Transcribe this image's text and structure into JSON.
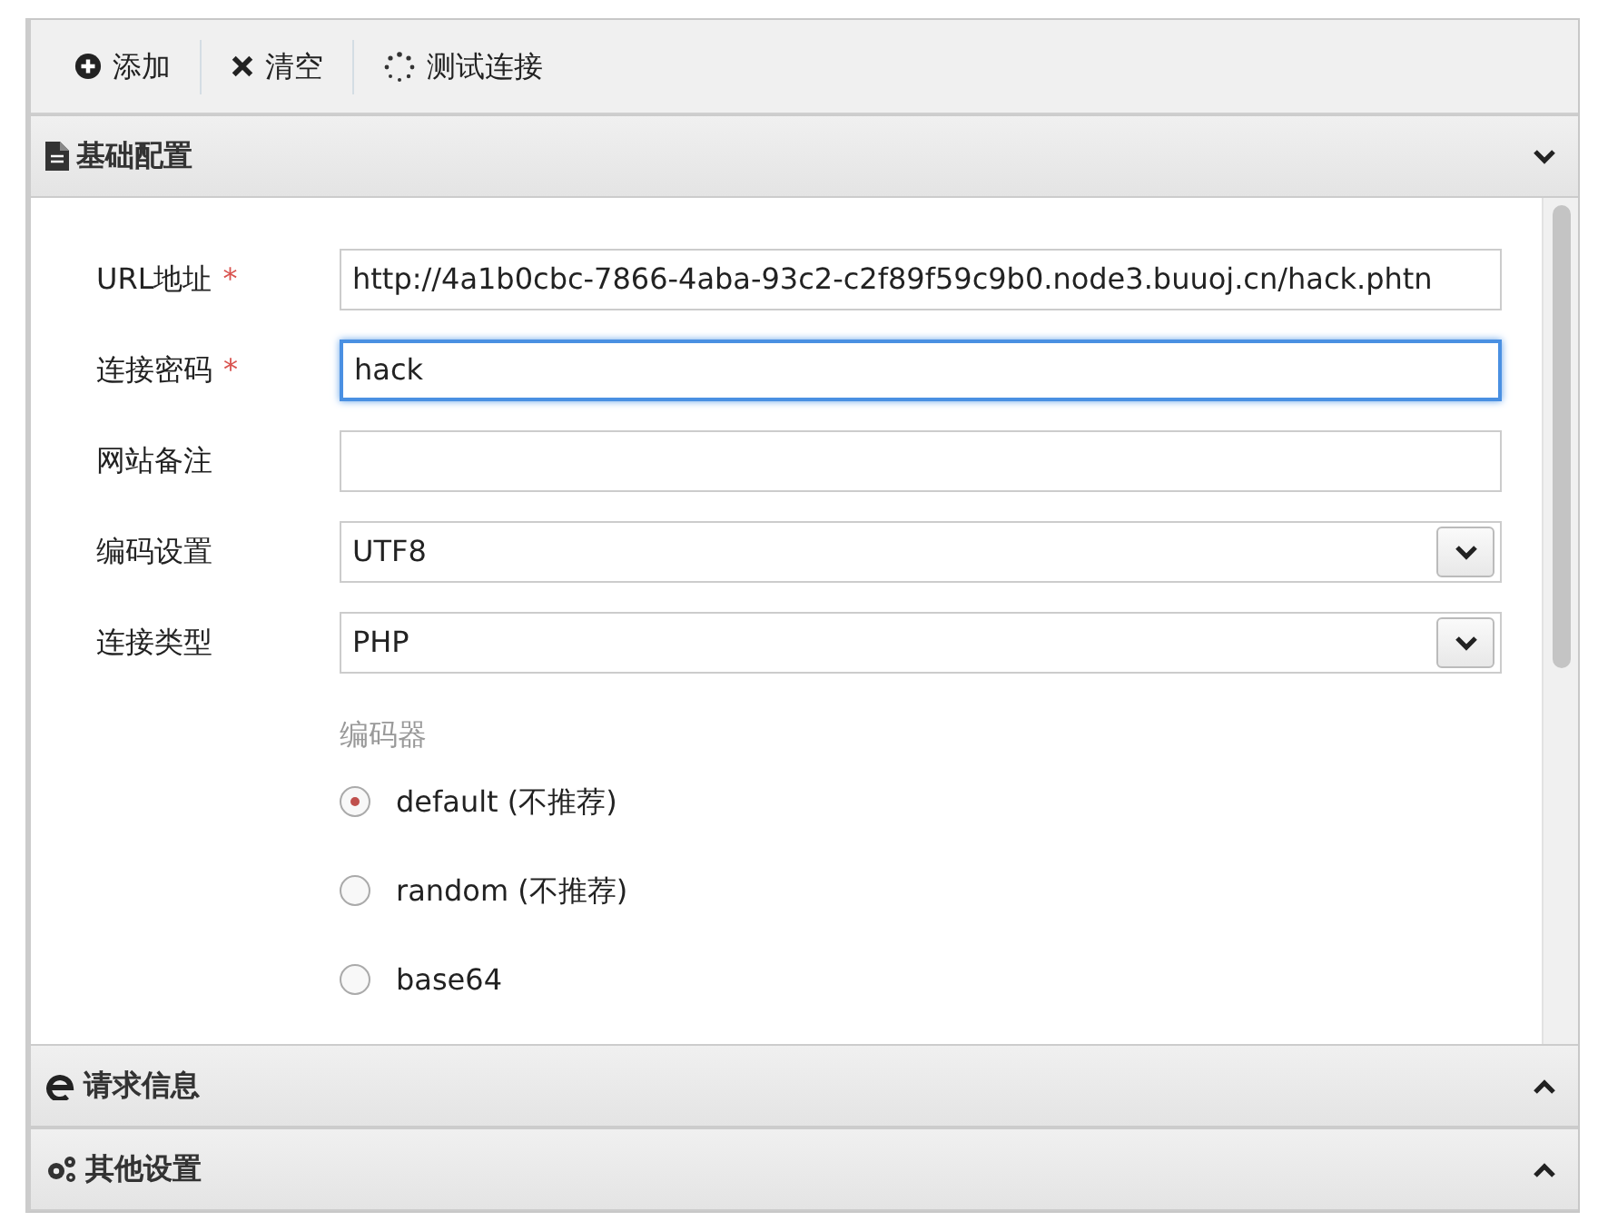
{
  "toolbar": [
    {
      "label": "添加"
    },
    {
      "label": "清空"
    },
    {
      "label": "测试连接"
    }
  ],
  "sections": [
    {
      "title": "基础配置",
      "expanded": true,
      "fields": [
        {
          "kind": "text",
          "label": "URL地址",
          "required_mark": "*",
          "value": "http://4a1b0cbc-7866-4aba-93c2-c2f89f59c9b0.node3.buuoj.cn/hack.phtn",
          "focused": false
        },
        {
          "kind": "text",
          "label": "连接密码",
          "required_mark": "*",
          "value": "hack",
          "focused": true
        },
        {
          "kind": "text",
          "label": "网站备注",
          "focused": false
        },
        {
          "kind": "select",
          "label": "编码设置",
          "value": "UTF8",
          "focused": false
        },
        {
          "kind": "select",
          "label": "连接类型",
          "value": "PHP",
          "focused": false
        }
      ],
      "encoder": {
        "title": "编码器",
        "options": [
          {
            "label": "default (不推荐)",
            "selected": true
          },
          {
            "label": "random (不推荐)",
            "selected": false
          },
          {
            "label": "base64",
            "selected": false
          }
        ]
      }
    },
    {
      "title": "请求信息",
      "expanded": false
    },
    {
      "title": "其他设置",
      "expanded": false
    }
  ]
}
